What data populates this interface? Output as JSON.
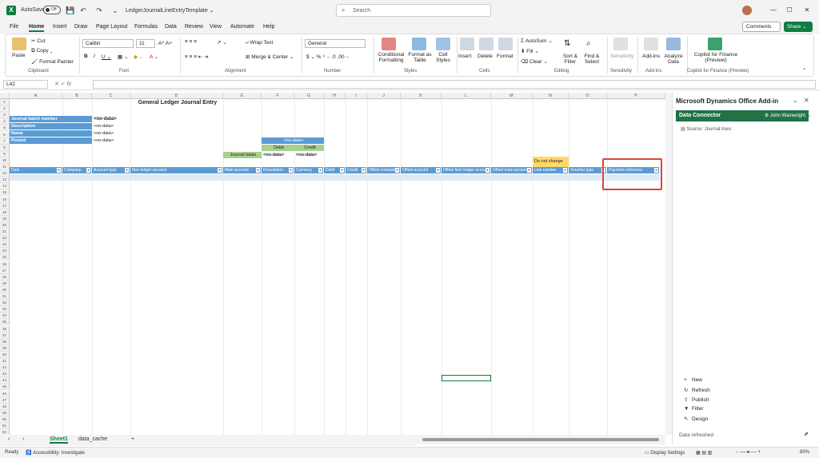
{
  "titlebar": {
    "autosave_label": "AutoSave",
    "autosave_state": "Off",
    "file_name": "LedgerJournalLineEntryTemplate",
    "search_placeholder": "Search"
  },
  "menu": {
    "items": [
      "File",
      "Home",
      "Insert",
      "Draw",
      "Page Layout",
      "Formulas",
      "Data",
      "Review",
      "View",
      "Automate",
      "Help"
    ],
    "active": "Home",
    "comments": "Comments",
    "share": "Share"
  },
  "ribbon": {
    "clipboard": {
      "paste": "Paste",
      "cut": "Cut",
      "copy": "Copy",
      "format_painter": "Format Painter",
      "label": "Clipboard"
    },
    "font": {
      "name": "Calibri",
      "size": "11",
      "label": "Font"
    },
    "alignment": {
      "wrap": "Wrap Text",
      "merge": "Merge & Center",
      "label": "Alignment"
    },
    "number": {
      "format": "General",
      "label": "Number"
    },
    "styles": {
      "conditional": "Conditional Formatting",
      "format_table": "Format as Table",
      "cell_styles": "Cell Styles",
      "label": "Styles"
    },
    "cells": {
      "insert": "Insert",
      "delete": "Delete",
      "format": "Format",
      "label": "Cells"
    },
    "editing": {
      "autosum": "AutoSum",
      "fill": "Fill",
      "clear": "Clear",
      "sort": "Sort & Filter",
      "find": "Find & Select",
      "label": "Editing"
    },
    "sensitivity": {
      "btn": "Sensitivity",
      "label": "Sensitivity"
    },
    "addins": {
      "btn": "Add-ins",
      "analyze": "Analyze Data",
      "label": "Add-ins"
    },
    "copilot": {
      "btn": "Copilot for Finance (Preview)",
      "label": "Copilot for Finance (Preview)"
    }
  },
  "formula_bar": {
    "cell_ref": "L42",
    "value": ""
  },
  "sheet": {
    "columns": [
      "A",
      "B",
      "C",
      "D",
      "E",
      "F",
      "G",
      "H",
      "I",
      "J",
      "K",
      "L",
      "M",
      "N",
      "O",
      "P"
    ],
    "title": "General Ledger Journal Entry",
    "info_labels": [
      "Journal batch number",
      "Description",
      "Name",
      "Posted"
    ],
    "info_values": [
      "<no-data>",
      "<no-data>",
      "<no-data>",
      "<no-data>"
    ],
    "summary_header": "<no-data>",
    "debit_label": "Debit",
    "credit_label": "Credit",
    "journal_totals": "Journal totals",
    "debit_value": "<no-data>",
    "credit_value": "<no-data>",
    "do_not_change": "Do not change",
    "headers": [
      "Date",
      "Company",
      "Account type",
      "Non ledger account",
      "Main account",
      "Description",
      "Currency",
      "Debit",
      "Credit",
      "Offset company",
      "Offset account",
      "Offset Non ledger account",
      "Offset main account",
      "Line number",
      "Voucher type",
      "Payment reference"
    ]
  },
  "tabs": {
    "sheets": [
      "Sheet1",
      "data_cache"
    ],
    "active": "Sheet1",
    "add": "+"
  },
  "status": {
    "ready": "Ready",
    "accessibility": "Accessibility: Investigate",
    "display": "Display Settings",
    "zoom": "80%"
  },
  "panel": {
    "title": "Microsoft Dynamics Office Add-in",
    "connector": "Data Connector",
    "user": "John Wainwright",
    "source": "Source: Journal lines",
    "actions": [
      "New",
      "Refresh",
      "Publish",
      "Filter",
      "Design"
    ],
    "footer": "Data refreshed"
  },
  "colors": {
    "excel_green": "#107c41",
    "header_blue": "#5b9bd5",
    "highlight_red": "#d9453c"
  }
}
